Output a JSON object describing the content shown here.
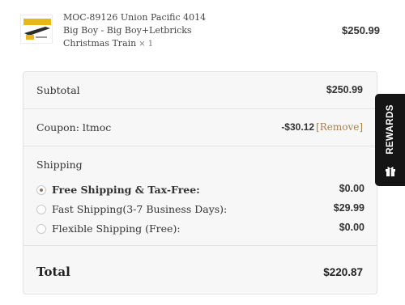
{
  "product": {
    "name_line1": "MOC-89126 Union Pacific 4014",
    "name_line2": "Big Boy - Big Boy+Letbricks",
    "name_line3": "Christmas Train",
    "quantity": "× 1",
    "price": "$250.99",
    "thumbnail_icon": "train-thumbnail-icon"
  },
  "summary": {
    "subtotal_label": "Subtotal",
    "subtotal_value": "$250.99",
    "coupon_label": "Coupon: ltmoc",
    "coupon_amount": "-$30.12",
    "coupon_remove": "[Remove]",
    "shipping_heading": "Shipping",
    "shipping_options": [
      {
        "label": "Free Shipping & Tax-Free:",
        "price": "$0.00",
        "selected": true
      },
      {
        "label": "Fast Shipping(3-7 Business Days):",
        "price": "$29.99",
        "selected": false
      },
      {
        "label": "Flexible Shipping (Free):",
        "price": "$0.00",
        "selected": false
      }
    ],
    "total_label": "Total",
    "total_value": "$220.87"
  },
  "rewards": {
    "label": "REWARDS",
    "icon": "gift-icon"
  },
  "colors": {
    "accent_link": "#a7804a",
    "rewards_bg": "#151515",
    "summary_bg": "#f7f7f7"
  }
}
